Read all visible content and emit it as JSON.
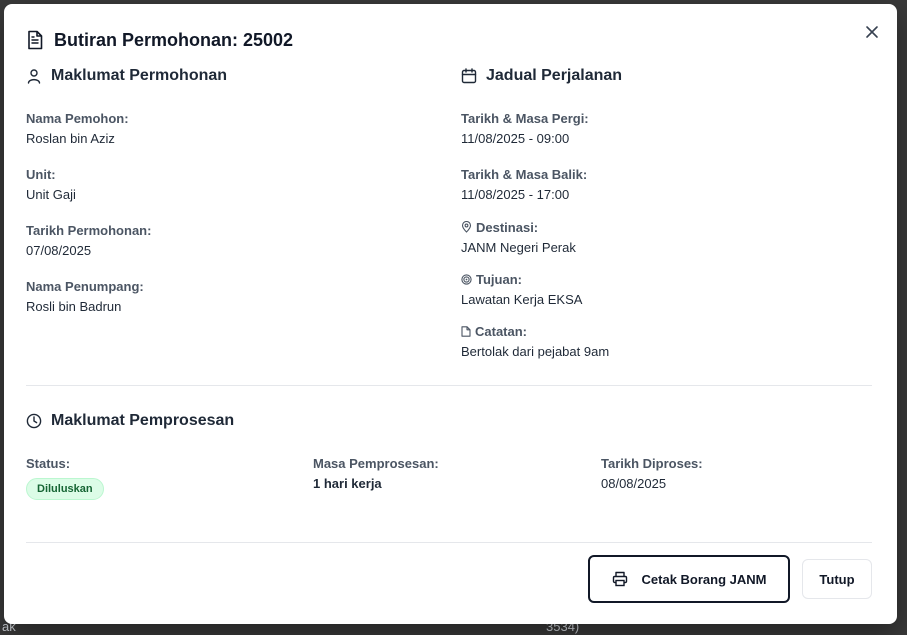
{
  "background": {
    "left_text": "ak",
    "right_text": "3534)"
  },
  "modal": {
    "title": "Butiran Permohonan: 25002",
    "close_icon": "x-icon"
  },
  "maklumat": {
    "heading": "Maklumat Permohonan",
    "icon": "user-icon",
    "nama_label": "Nama Pemohon:",
    "nama_value": "Roslan bin Aziz",
    "unit_label": "Unit:",
    "unit_value": "Unit Gaji",
    "tarikh_label": "Tarikh Permohonan:",
    "tarikh_value": "07/08/2025",
    "penumpang_label": "Nama Penumpang:",
    "penumpang_value": "Rosli bin Badrun"
  },
  "jadual": {
    "heading": "Jadual Perjalanan",
    "icon": "calendar-icon",
    "pergi_label": "Tarikh & Masa Pergi:",
    "pergi_value": "11/08/2025 - 09:00",
    "balik_label": "Tarikh & Masa Balik:",
    "balik_value": "11/08/2025 - 17:00",
    "destinasi_label": "Destinasi:",
    "destinasi_value": "JANM Negeri Perak",
    "tujuan_label": "Tujuan:",
    "tujuan_value": "Lawatan Kerja EKSA",
    "catatan_label": "Catatan:",
    "catatan_value": "Bertolak dari pejabat 9am"
  },
  "pemprosesan": {
    "heading": "Maklumat Pemprosesan",
    "icon": "clock-icon",
    "status_label": "Status:",
    "status_value": "Diluluskan",
    "masa_label": "Masa Pemprosesan:",
    "masa_value": "1 hari kerja",
    "diproses_label": "Tarikh Diproses:",
    "diproses_value": "08/08/2025"
  },
  "footer": {
    "print_label": "Cetak Borang JANM",
    "close_label": "Tutup"
  },
  "colors": {
    "badge_bg": "#dcfce7",
    "badge_text": "#166534"
  }
}
